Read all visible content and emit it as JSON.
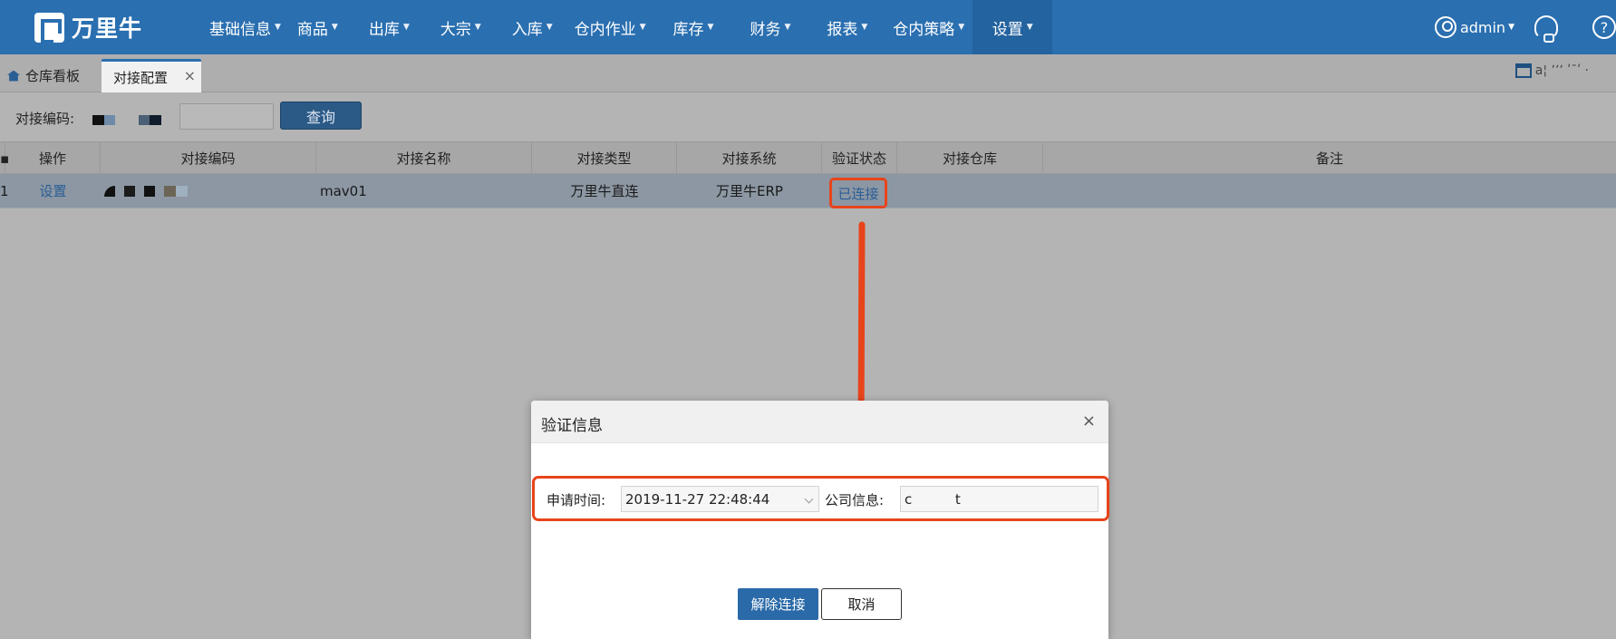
{
  "logo": {
    "text": "万里牛"
  },
  "menu": [
    {
      "label": "基础信息"
    },
    {
      "label": "商品"
    },
    {
      "label": "出库"
    },
    {
      "label": "大宗"
    },
    {
      "label": "入库"
    },
    {
      "label": "仓内作业"
    },
    {
      "label": "库存"
    },
    {
      "label": "财务"
    },
    {
      "label": "报表"
    },
    {
      "label": "仓内策略"
    },
    {
      "label": "设置",
      "active": true
    }
  ],
  "user": {
    "name": "admin"
  },
  "tabs": {
    "home": "仓库看板",
    "active": "对接配置",
    "close": "×",
    "right_text": "a¦  ʼʼʼ ʹ¯ʹ  ·"
  },
  "search": {
    "label": "对接编码:",
    "button": "查询",
    "placeholder": ""
  },
  "table": {
    "headers": [
      "操作",
      "对接编码",
      "对接名称",
      "对接类型",
      "对接系统",
      "验证状态",
      "对接仓库",
      "备注"
    ],
    "rows": [
      {
        "index": "1",
        "action": "设置",
        "code": "",
        "name": "mav01",
        "type": "万里牛直连",
        "system": "万里牛ERP",
        "status": "已连接",
        "warehouse": "",
        "remark": ""
      }
    ]
  },
  "modal": {
    "title": "验证信息",
    "close": "×",
    "apply_time_label": "申请时间:",
    "apply_time_value": "2019-11-27 22:48:44",
    "company_label": "公司信息:",
    "company_value": "c          t",
    "disconnect_button": "解除连接",
    "cancel_button": "取消"
  },
  "colors": {
    "nav": "#2a6fb0",
    "highlight": "#e8441b",
    "primary_button": "#2b6aa8"
  }
}
